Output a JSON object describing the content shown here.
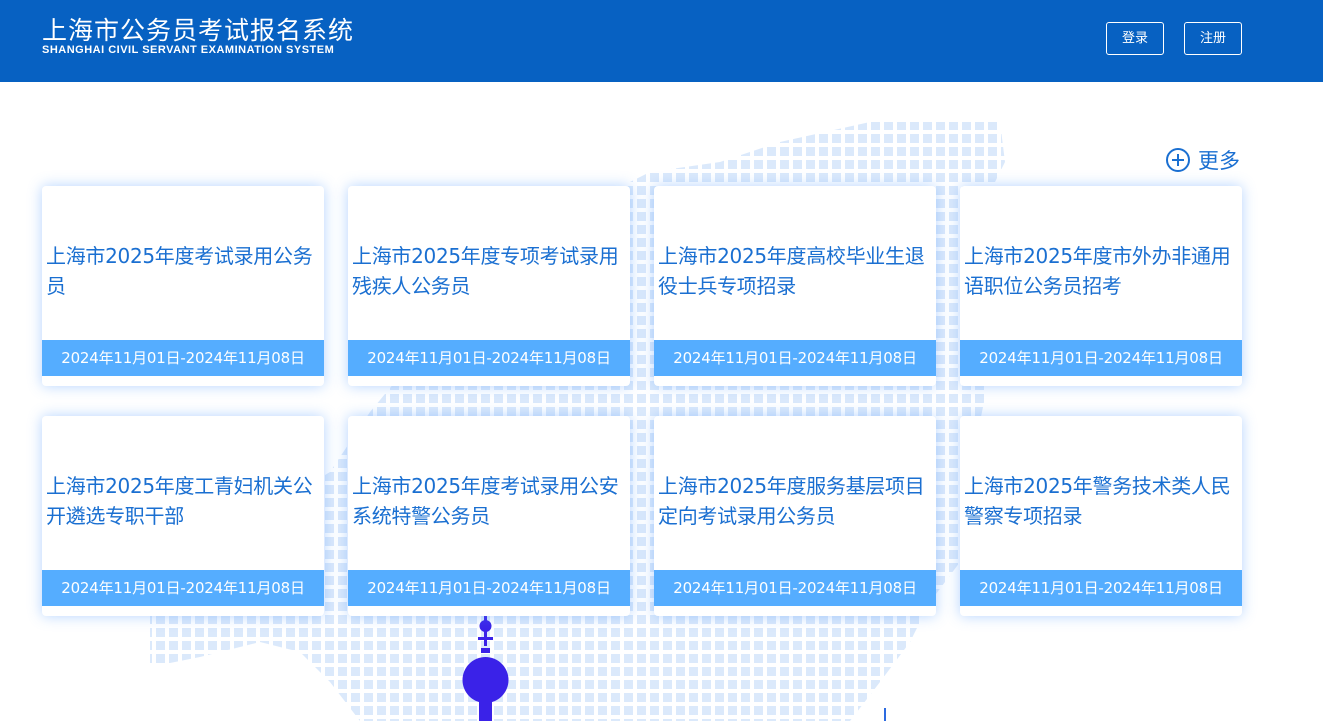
{
  "header": {
    "title": "上海市公务员考试报名系统",
    "subtitle": "SHANGHAI CIVIL SERVANT EXAMINATION SYSTEM",
    "login_label": "登录",
    "register_label": "注册"
  },
  "more": {
    "label": "更多",
    "icon": "plus-circle-icon"
  },
  "cards": [
    {
      "title": "上海市2025年度考试录用公务员",
      "date": "2024年11月01日-2024年11月08日"
    },
    {
      "title": "上海市2025年度专项考试录用残疾人公务员",
      "date": "2024年11月01日-2024年11月08日"
    },
    {
      "title": "上海市2025年度高校毕业生退役士兵专项招录",
      "date": "2024年11月01日-2024年11月08日"
    },
    {
      "title": "上海市2025年度市外办非通用语职位公务员招考",
      "date": "2024年11月01日-2024年11月08日"
    },
    {
      "title": "上海市2025年度工青妇机关公开遴选专职干部",
      "date": "2024年11月01日-2024年11月08日"
    },
    {
      "title": "上海市2025年度考试录用公安系统特警公务员",
      "date": "2024年11月01日-2024年11月08日"
    },
    {
      "title": "上海市2025年度服务基层项目定向考试录用公务员",
      "date": "2024年11月01日-2024年11月08日"
    },
    {
      "title": "上海市2025年警务技术类人民警察专项招录",
      "date": "2024年11月01日-2024年11月08日"
    }
  ],
  "colors": {
    "header_bg": "#0761c2",
    "accent_text": "#1a6fd1",
    "date_bar": "#55adff",
    "map_dots": "#dbe9fb",
    "tower": "#3a22e8"
  }
}
